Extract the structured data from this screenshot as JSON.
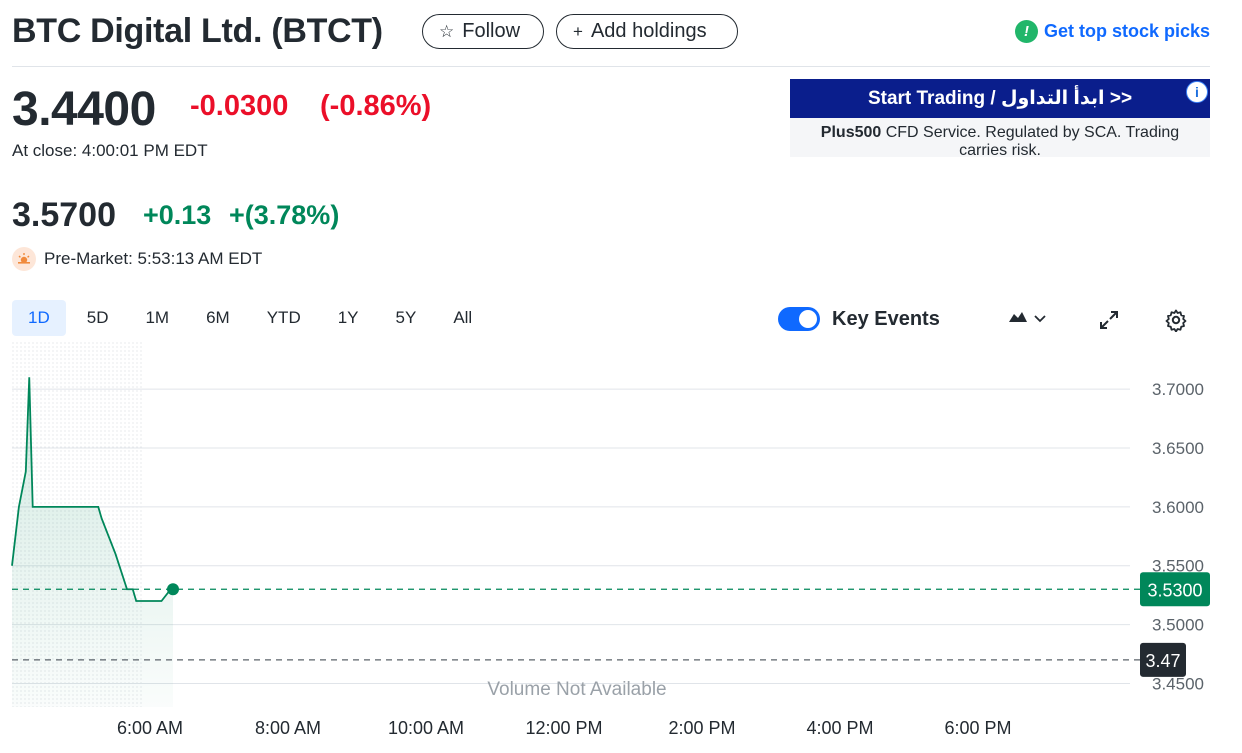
{
  "header": {
    "title": "BTC Digital Ltd. (BTCT)",
    "follow_label": "Follow",
    "add_holdings_label": "Add holdings",
    "top_picks_label": "Get top stock picks"
  },
  "quote": {
    "price": "3.4400",
    "change": "-0.0300",
    "change_pct": "(-0.86%)",
    "close_time": "At close: 4:00:01 PM EDT",
    "pre_price": "3.5700",
    "pre_change": "+0.13",
    "pre_change_pct": "+(3.78%)",
    "pre_time": "Pre-Market: 5:53:13 AM EDT"
  },
  "ad": {
    "button_label": "Start Trading / ابدأ التداول >>",
    "brand": "Plus500",
    "text": " CFD Service. Regulated by SCA. Trading carries risk.",
    "info_icon": "i"
  },
  "range_tabs": [
    "1D",
    "5D",
    "1M",
    "6M",
    "YTD",
    "1Y",
    "5Y",
    "All"
  ],
  "active_tab": "1D",
  "controls": {
    "key_events_label": "Key Events",
    "key_events_on": true
  },
  "colors": {
    "negative": "#eb0f29",
    "positive": "#00875a",
    "link": "#0f69ff",
    "ad_blue": "#0a1e8c"
  },
  "chart_data": {
    "type": "line",
    "series": [
      {
        "values": [
          [
            "4:00 AM",
            3.55
          ],
          [
            "4:06 AM",
            3.6
          ],
          [
            "4:12 AM",
            3.63
          ],
          [
            "4:15 AM",
            3.71
          ],
          [
            "4:18 AM",
            3.6
          ],
          [
            "4:30 AM",
            3.6
          ],
          [
            "5:15 AM",
            3.6
          ],
          [
            "5:18 AM",
            3.59
          ],
          [
            "5:30 AM",
            3.56
          ],
          [
            "5:40 AM",
            3.53
          ],
          [
            "5:45 AM",
            3.53
          ],
          [
            "5:48 AM",
            3.52
          ],
          [
            "6:10 AM",
            3.52
          ],
          [
            "6:18 AM",
            3.53
          ],
          [
            "6:20 AM",
            3.53
          ]
        ]
      }
    ],
    "y_ticks": [
      "3.7000",
      "3.6500",
      "3.6000",
      "3.5500",
      "3.5000",
      "3.4500"
    ],
    "ylim": [
      3.43,
      3.74
    ],
    "x_ticks": [
      "6:00 AM",
      "8:00 AM",
      "10:00 AM",
      "12:00 PM",
      "2:00 PM",
      "4:00 PM",
      "6:00 PM"
    ],
    "current_price_label": "3.5300",
    "current_price": 3.53,
    "prev_close_label": "3.47",
    "prev_close": 3.47,
    "volume_note": "Volume Not Available",
    "grid": true
  }
}
